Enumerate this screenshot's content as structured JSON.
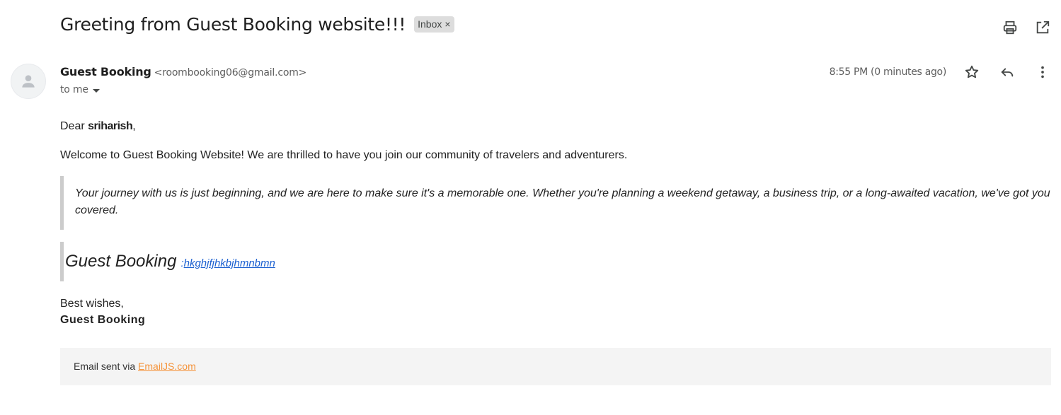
{
  "subject": "Greeting from Guest Booking website!!!",
  "label": {
    "name": "Inbox",
    "remove_glyph": "×"
  },
  "top_actions": [
    {
      "icon": "print-icon"
    },
    {
      "icon": "open-in-new-window-icon"
    }
  ],
  "sender": {
    "name": "Guest Booking",
    "email": "<roombooking06@gmail.com>",
    "recipient": "to me",
    "avatar_icon": "person-icon"
  },
  "timestamp": "8:55 PM (0 minutes ago)",
  "message_actions": [
    {
      "icon": "star-icon"
    },
    {
      "icon": "reply-icon"
    },
    {
      "icon": "more-vert-icon"
    }
  ],
  "body": {
    "greeting_prefix": "Dear ",
    "recipient_name": "sriharish",
    "greeting_suffix": ",",
    "welcome": "Welcome to  Guest Booking Website! We are thrilled to have you join our community of travelers and adventurers.",
    "quote": "Your journey with us is just beginning, and we are here to make sure it's a memorable one. Whether you're planning a weekend getaway, a business trip, or a long-awaited vacation, we've got you covered.",
    "signature_title": "Guest Booking",
    "signature_link_prefix": ":",
    "signature_link": "hkghjfjhkbjhmnbmn",
    "closing": "Best wishes,",
    "closing_team": "Guest Booking"
  },
  "footer": {
    "prefix": "Email sent via ",
    "link": "EmailJS.com",
    "link_color": "#f5933a"
  },
  "colors": {
    "label_bg": "#dddddd",
    "link": "#1a5fd0",
    "quote_border": "#cccccc",
    "footer_bg": "#f4f4f4"
  }
}
